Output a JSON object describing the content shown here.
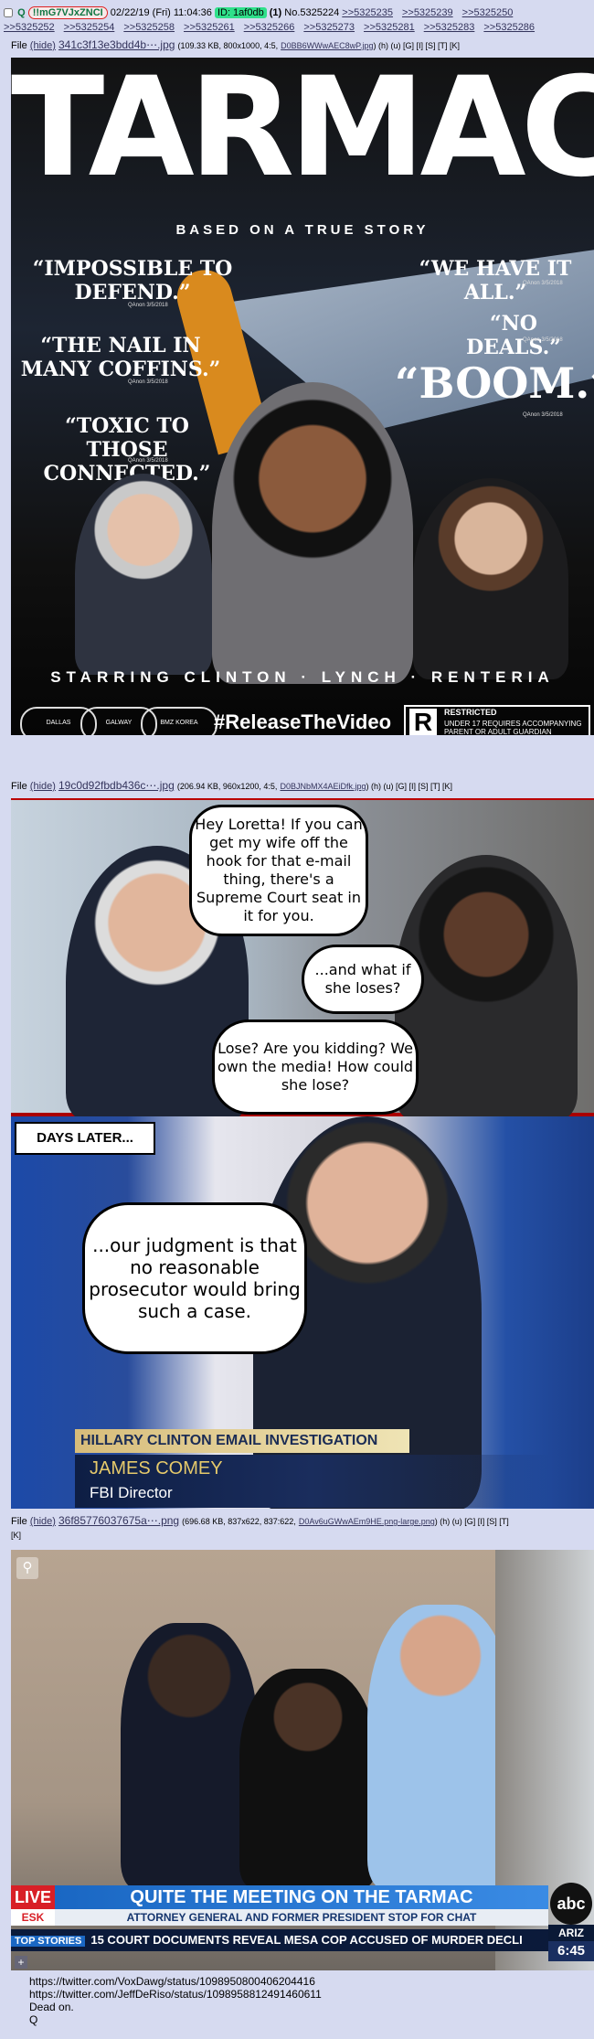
{
  "post": {
    "name": "Q",
    "tripcode": "!!mG7VJxZNCI",
    "date": "02/22/19 (Fri) 11:04:36",
    "id_label": "ID: 1af0db",
    "id_count": "(1)",
    "number": "No.5325224",
    "backlinks": [
      ">>5325235",
      ">>5325239",
      ">>5325250",
      ">>5325252",
      ">>5325254",
      ">>5325258",
      ">>5325261",
      ">>5325266",
      ">>5325273",
      ">>5325281",
      ">>5325283",
      ">>5325286"
    ]
  },
  "files": [
    {
      "label": "File",
      "hide": "(hide)",
      "name": "341c3f13e3bdd4b⋯.jpg",
      "info": "(109.33 KB, 800x1000, 4:5,",
      "orig": "D0BB6WWwAEC8wP.jpg",
      "tail": ") (h) (u) [G] [I] [S] [T] [K]"
    },
    {
      "label": "File",
      "hide": "(hide)",
      "name": "19c0d92fbdb436c⋯.jpg",
      "info": "(206.94 KB, 960x1200, 4:5,",
      "orig": "D0BJNbMX4AEiDfk.jpg",
      "tail": ") (h) (u) [G] [I] [S] [T] [K]"
    },
    {
      "label": "File",
      "hide": "(hide)",
      "name": "36f85776037675a⋯.png",
      "info": "(696.68 KB, 837x622, 837:622,",
      "orig": "D0Av6uGWwAEm9HE.png-large.png",
      "tail": ") (h) (u) [G] [I] [S] [T]",
      "tail2": "[K]"
    }
  ],
  "poster": {
    "title": "TARMAC",
    "tagline": "BASED ON A TRUE STORY",
    "quotes": [
      "“IMPOSSIBLE TO DEFEND.”",
      "“THE NAIL IN MANY COFFINS.”",
      "“TOXIC TO THOSE CONNECTED.”",
      "“WE HAVE IT ALL.”",
      "“NO DEALS.”",
      "“BOOM.”"
    ],
    "quote_attrib": "QAnon 3/5/2018",
    "starring": "STARRING CLINTON · LYNCH · RENTERIA",
    "laurels": [
      "DALLAS",
      "GALWAY",
      "BMZ KOREA"
    ],
    "hashtag": "#ReleaseTheVideo",
    "rating_letter": "R",
    "rating_title": "RESTRICTED",
    "rating_text": "UNDER 17 REQUIRES ACCOMPANYING PARENT OR ADULT GUARDIAN"
  },
  "comic": {
    "bubble1": "Hey Loretta!  If you can get my wife off the hook for that e-mail thing, there's a Supreme Court seat in it for you.",
    "bubble2": "...and what if she loses?",
    "bubble3": "Lose? Are you kidding? We own the media! How could she lose?",
    "days_later": "DAYS LATER...",
    "bubble4": "...our judgment is that no reasonable prosecutor would bring such a case.",
    "lower_third_title": "HILLARY CLINTON EMAIL INVESTIGATION",
    "lower_third_name": "JAMES COMEY",
    "lower_third_role": "FBI Director"
  },
  "news": {
    "live": "LIVE",
    "desk": "ESK",
    "headline": "QUITE THE MEETING ON THE TARMAC",
    "subhead": "ATTORNEY GENERAL AND FORMER PRESIDENT STOP FOR CHAT",
    "network": "abc",
    "region": "ARIZ",
    "ticker_label": "TOP STORIES",
    "ticker_text": "15  COURT DOCUMENTS REVEAL MESA COP ACCUSED OF MURDER DECLI",
    "time": "6:45"
  },
  "body": {
    "line1": "https://twitter.com/VoxDawg/status/1098950800406204416",
    "line2": "https://twitter.com/JeffDeRiso/status/1098958812491460611",
    "line3": "Dead on.",
    "line4": "Q"
  },
  "colors": {
    "background": "#d6daf0",
    "link": "#34345c",
    "trip": "#117743",
    "id_badge": "#2fe08a"
  }
}
